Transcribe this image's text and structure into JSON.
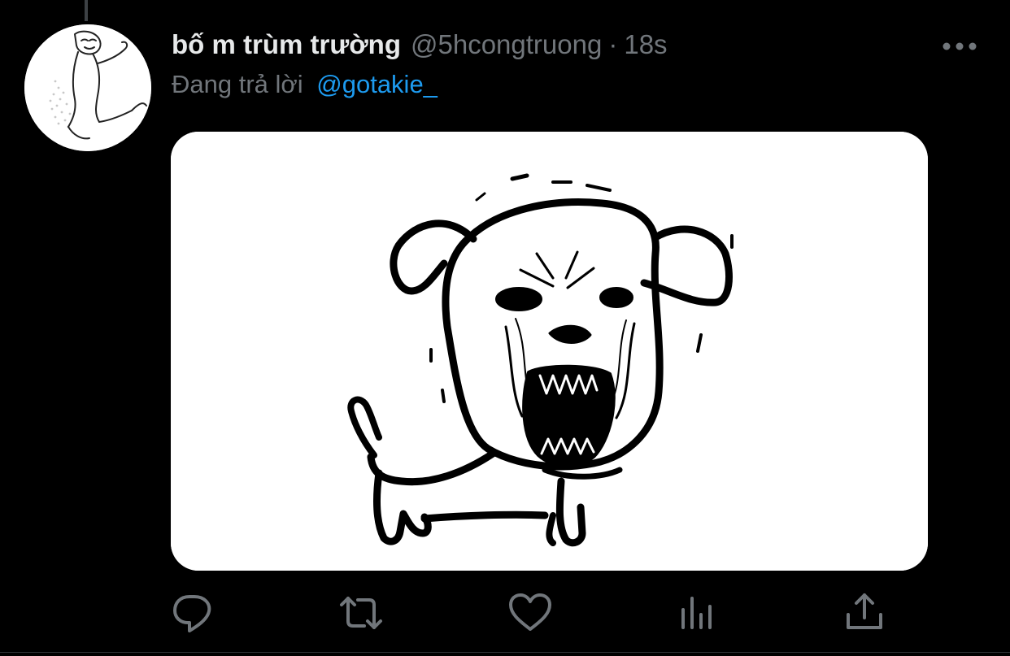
{
  "tweet": {
    "display_name": "bố m trùm trường",
    "handle": "@5hcongtruong",
    "separator": "·",
    "time": "18s",
    "reply_prefix": "Đang trả lời",
    "reply_to": "@gotakie_"
  },
  "actions": [
    {
      "name": "reply",
      "icon": "speech-bubble-icon"
    },
    {
      "name": "retweet",
      "icon": "retweet-arrows-icon"
    },
    {
      "name": "like",
      "icon": "heart-icon"
    },
    {
      "name": "analytics",
      "icon": "bar-chart-icon"
    },
    {
      "name": "share",
      "icon": "share-upload-icon"
    }
  ],
  "colors": {
    "background": "#000000",
    "text_primary": "#e7e9ea",
    "text_secondary": "#71767b",
    "accent": "#1d9bf0",
    "divider": "#2f3336"
  }
}
